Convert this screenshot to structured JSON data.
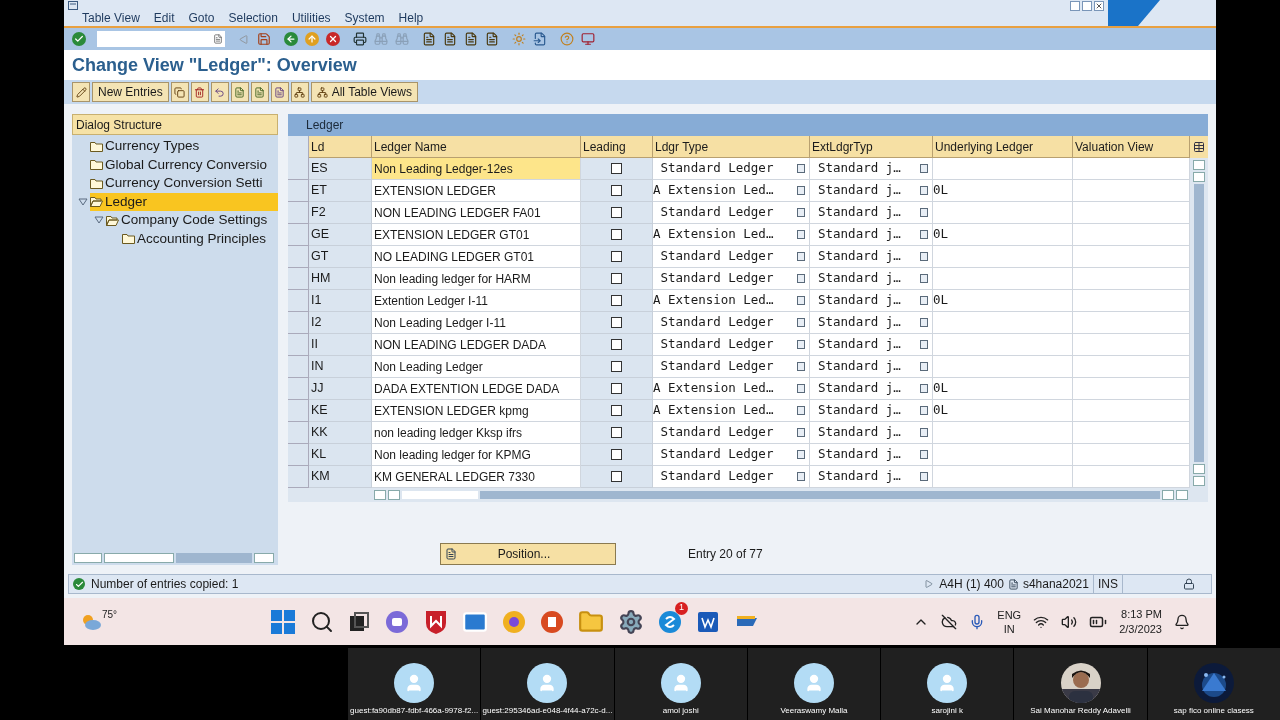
{
  "menu": [
    "Table View",
    "Edit",
    "Goto",
    "Selection",
    "Utilities",
    "System",
    "Help"
  ],
  "title": "Change View \"Ledger\": Overview",
  "app_toolbar": {
    "new_entries": "New Entries",
    "all_table_views": "All Table Views"
  },
  "dialog_structure": {
    "title": "Dialog Structure",
    "items": [
      {
        "label": "Currency Types",
        "selected": false
      },
      {
        "label": "Global Currency Conversio",
        "selected": false
      },
      {
        "label": "Currency Conversion Setti",
        "selected": false
      },
      {
        "label": "Ledger",
        "selected": true,
        "expanded": true,
        "children": [
          {
            "label": "Company Code Settings",
            "selected": false,
            "expanded": true,
            "children": [
              {
                "label": "Accounting Principles",
                "selected": false
              }
            ]
          }
        ]
      }
    ]
  },
  "table": {
    "title": "Ledger",
    "columns": [
      "Ld",
      "Ledger Name",
      "Leading",
      "Ldgr Type",
      "ExtLdgrTyp",
      "Underlying Ledger",
      "Valuation View"
    ],
    "rows": [
      {
        "ld": "ES",
        "name": "Non Leading Ledger-12es",
        "leading": false,
        "ldgr_type": " Standard Ledger",
        "ext_type": "Standard j…",
        "underlying": "",
        "selected": true
      },
      {
        "ld": "ET",
        "name": "EXTENSION LEDGER",
        "leading": false,
        "ldgr_type": "A Extension Led…",
        "ext_type": "Standard j…",
        "underlying": "0L",
        "selected": false
      },
      {
        "ld": "F2",
        "name": "NON LEADING LEDGER FA01",
        "leading": false,
        "ldgr_type": " Standard Ledger",
        "ext_type": "Standard j…",
        "underlying": "",
        "selected": false
      },
      {
        "ld": "GE",
        "name": "EXTENSION LEDGER GT01",
        "leading": false,
        "ldgr_type": "A Extension Led…",
        "ext_type": "Standard j…",
        "underlying": "0L",
        "selected": false
      },
      {
        "ld": "GT",
        "name": "NO LEADING LEDGER GT01",
        "leading": false,
        "ldgr_type": " Standard Ledger",
        "ext_type": "Standard j…",
        "underlying": "",
        "selected": false
      },
      {
        "ld": "HM",
        "name": "Non leading ledger for HARM",
        "leading": false,
        "ldgr_type": " Standard Ledger",
        "ext_type": "Standard j…",
        "underlying": "",
        "selected": false
      },
      {
        "ld": "I1",
        "name": "Extention Ledger I-11",
        "leading": false,
        "ldgr_type": "A Extension Led…",
        "ext_type": "Standard j…",
        "underlying": "0L",
        "selected": false
      },
      {
        "ld": "I2",
        "name": "Non Leading Ledger I-11",
        "leading": false,
        "ldgr_type": " Standard Ledger",
        "ext_type": "Standard j…",
        "underlying": "",
        "selected": false
      },
      {
        "ld": "II",
        "name": "NON LEADING LEDGER DADA",
        "leading": false,
        "ldgr_type": " Standard Ledger",
        "ext_type": "Standard j…",
        "underlying": "",
        "selected": false
      },
      {
        "ld": "IN",
        "name": "Non Leading Ledger",
        "leading": false,
        "ldgr_type": " Standard Ledger",
        "ext_type": "Standard j…",
        "underlying": "",
        "selected": false
      },
      {
        "ld": "JJ",
        "name": "DADA EXTENTION LEDGE DADA",
        "leading": false,
        "ldgr_type": "A Extension Led…",
        "ext_type": "Standard j…",
        "underlying": "0L",
        "selected": false
      },
      {
        "ld": "KE",
        "name": "EXTENSION LEDGER kpmg",
        "leading": false,
        "ldgr_type": "A Extension Led…",
        "ext_type": "Standard j…",
        "underlying": "0L",
        "selected": false
      },
      {
        "ld": "KK",
        "name": "non leading ledger Kksp ifrs",
        "leading": false,
        "ldgr_type": " Standard Ledger",
        "ext_type": "Standard j…",
        "underlying": "",
        "selected": false
      },
      {
        "ld": "KL",
        "name": "Non leading ledger for KPMG",
        "leading": false,
        "ldgr_type": " Standard Ledger",
        "ext_type": "Standard j…",
        "underlying": "",
        "selected": false
      },
      {
        "ld": "KM",
        "name": "KM GENERAL LEDGER 7330",
        "leading": false,
        "ldgr_type": " Standard Ledger",
        "ext_type": "Standard j…",
        "underlying": "",
        "selected": false
      }
    ]
  },
  "position_button": "Position...",
  "entry_info": "Entry 20 of 77",
  "status_bar": {
    "message": "Number of entries copied: 1",
    "system": "A4H (1) 400",
    "server": "s4hana2021",
    "mode": "INS"
  },
  "taskbar": {
    "weather": "75°",
    "notification_count": "1",
    "language": "ENG",
    "region": "IN",
    "time": "8:13 PM",
    "date": "2/3/2023"
  },
  "participants": [
    {
      "name": "guest:fa90db87-fdbf-466a-9978-f2...",
      "kind": "avatar"
    },
    {
      "name": "guest:295346ad-e048-4f44-a72c-d...",
      "kind": "avatar"
    },
    {
      "name": "amol joshi",
      "kind": "avatar"
    },
    {
      "name": "Veeraswamy Malla",
      "kind": "avatar"
    },
    {
      "name": "sarojini k",
      "kind": "avatar"
    },
    {
      "name": "Sai Manohar Reddy Adavelli"
    },
    {
      "name": "sap fico online clasess",
      "kind": "logo"
    }
  ]
}
